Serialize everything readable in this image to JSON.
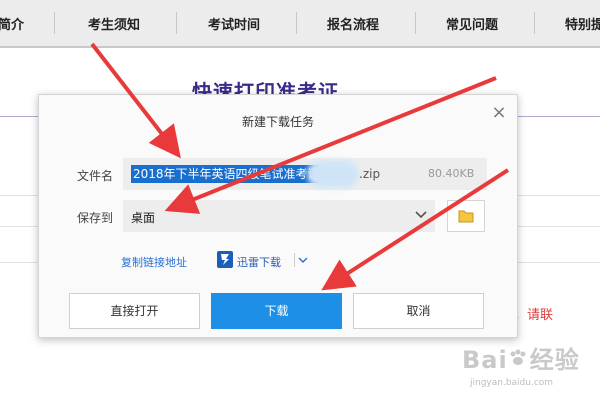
{
  "nav": {
    "items": [
      "简介",
      "考生须知",
      "考试时间",
      "报名流程",
      "常见问题",
      "特别提"
    ]
  },
  "background": {
    "title": "快速打印准考证",
    "red_text": "，请联"
  },
  "dialog": {
    "title": "新建下载任务",
    "filename_label": "文件名",
    "filename_selected": "2018年下半年英语四级笔试准考证",
    "filename_ext": ".zip",
    "file_size": "80.40KB",
    "save_label": "保存到",
    "save_location": "桌面",
    "copy_link": "复制链接地址",
    "xunlei_label": "迅雷下载",
    "buttons": {
      "open": "直接打开",
      "download": "下载",
      "cancel": "取消"
    },
    "close_symbol": "×"
  },
  "watermark": {
    "brand_left": "Bai",
    "brand_right": "经验",
    "url": "jingyan.baidu.com"
  },
  "colors": {
    "accent_blue": "#1e8fe6",
    "selection_blue": "#1a6fce",
    "link_blue": "#2a6fd1",
    "arrow_red": "#e83a3a",
    "title_purple": "#3b2a8a"
  }
}
